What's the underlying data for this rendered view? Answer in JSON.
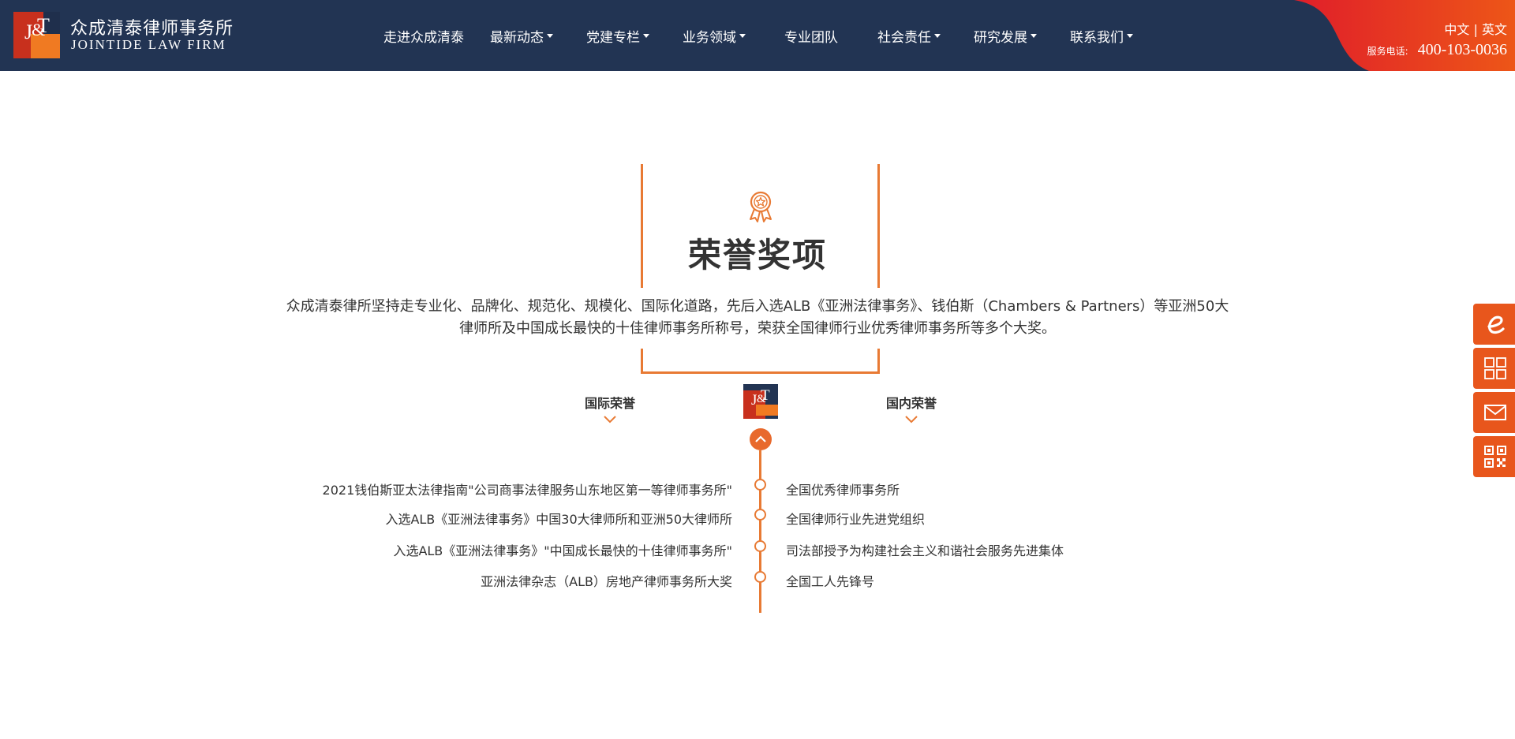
{
  "header": {
    "brand_cn": "众成清泰律师事务所",
    "brand_en": "JOINTIDE LAW FIRM",
    "nav": [
      {
        "label": "走进众成清泰",
        "dropdown": false
      },
      {
        "label": "最新动态",
        "dropdown": true
      },
      {
        "label": "党建专栏",
        "dropdown": true
      },
      {
        "label": "业务领域",
        "dropdown": true
      },
      {
        "label": "专业团队",
        "dropdown": false
      },
      {
        "label": "社会责任",
        "dropdown": true
      },
      {
        "label": "研究发展",
        "dropdown": true
      },
      {
        "label": "联系我们",
        "dropdown": true
      }
    ],
    "lang_cn": "中文",
    "lang_sep": "|",
    "lang_en": "英文",
    "phone_label": "服务电话:",
    "phone_number": "400-103-0036"
  },
  "section": {
    "title": "荣誉奖项",
    "intro": "众成清泰律所坚持走专业化、品牌化、规范化、规模化、国际化道路，先后入选ALB《亚洲法律事务》、钱伯斯（Chambers & Partners）等亚洲50大律师所及中国成长最快的十佳律师事务所称号，荣获全国律师行业优秀律师事务所等多个大奖。"
  },
  "timeline": {
    "left_category": "国际荣誉",
    "right_category": "国内荣誉",
    "left_items": [
      "2021钱伯斯亚太法律指南\"公司商事法律服务山东地区第一等律师事务所\"",
      "入选ALB《亚洲法律事务》中国30大律师所和亚洲50大律师所",
      "入选ALB《亚洲法律事务》\"中国成长最快的十佳律师事务所\"",
      "亚洲法律杂志（ALB）房地产律师事务所大奖"
    ],
    "right_items": [
      "全国优秀律师事务所",
      "全国律师行业先进党组织",
      "司法部授予为构建社会主义和谐社会服务先进集体",
      "全国工人先锋号"
    ]
  },
  "side_tools": [
    "e-icon",
    "apps-icon",
    "mail-icon",
    "qr-code-icon"
  ],
  "colors": {
    "header_bg": "#223453",
    "accent_orange": "#e87a34",
    "accent_red": "#e8561c"
  }
}
